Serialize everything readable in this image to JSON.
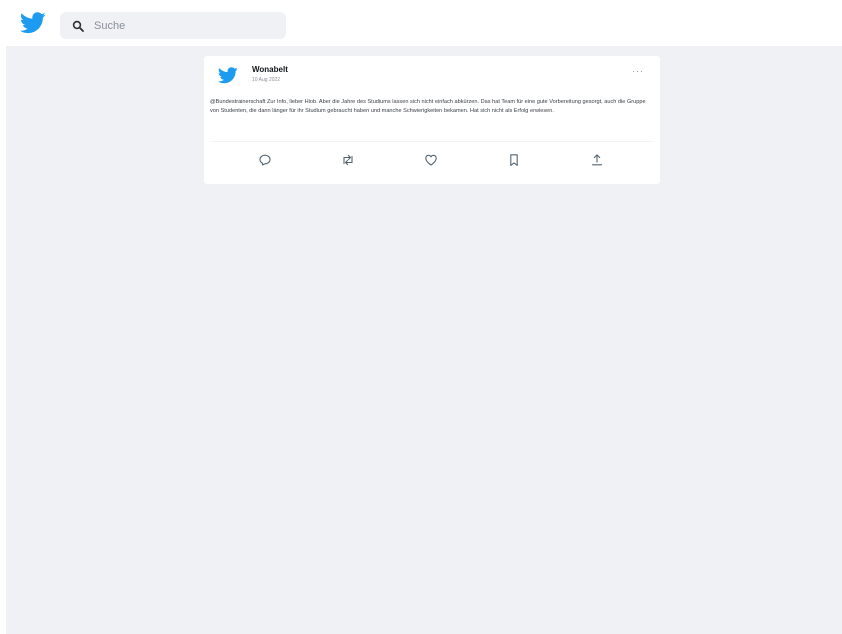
{
  "header": {
    "logo_icon": "twitter-bird-icon",
    "search": {
      "icon": "search-icon",
      "placeholder": "Suche",
      "value": ""
    }
  },
  "tweet": {
    "avatar_icon": "twitter-bird-icon",
    "author": "Wonabelt",
    "date": "10 Aug 2022",
    "more_icon": "more-options-icon",
    "more_label": "···",
    "text": "@Bundestrainerschaft Zur Info, lieber Hiob. Aber die Jahre des Studiums lassen sich nicht einfach abkürzen. Das hat Team für eine gute Vorbereitung gesorgt, auch die Gruppe von Studenten, die dann länger für ihr Studium gebraucht haben und manche Schwierigkeiten bekamen. Hat sich nicht als Erfolg erwiesen.",
    "actions": [
      {
        "name": "reply-button",
        "icon": "reply-icon"
      },
      {
        "name": "retweet-button",
        "icon": "retweet-icon"
      },
      {
        "name": "like-button",
        "icon": "heart-icon"
      },
      {
        "name": "bookmark-button",
        "icon": "bookmark-icon"
      },
      {
        "name": "share-button",
        "icon": "share-icon"
      }
    ]
  },
  "colors": {
    "brand": "#1d9bf0",
    "page_background": "#eff1f5",
    "card_background": "#ffffff",
    "icon_gray": "#536471"
  }
}
